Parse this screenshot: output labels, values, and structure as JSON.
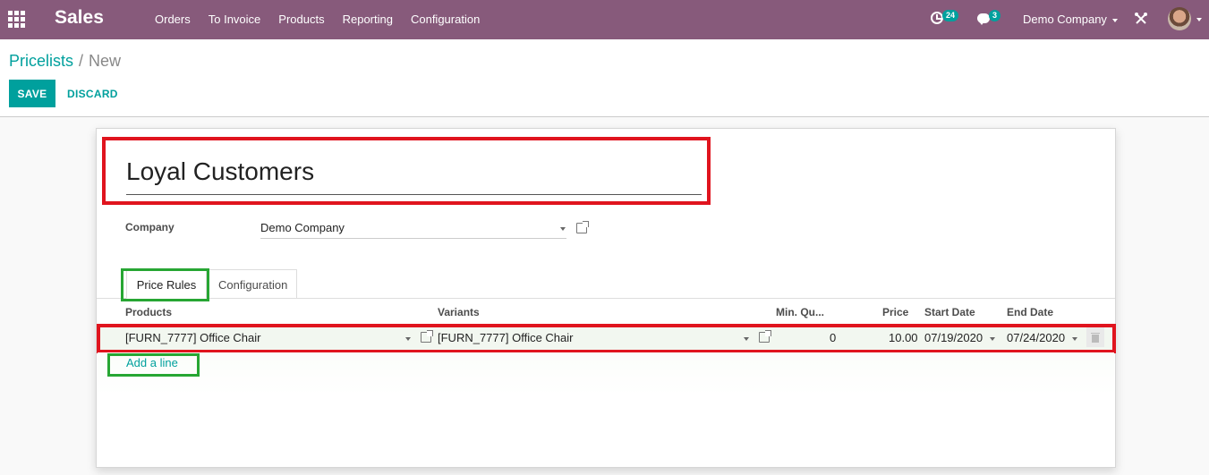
{
  "navbar": {
    "app_title": "Sales",
    "menu": [
      "Orders",
      "To Invoice",
      "Products",
      "Reporting",
      "Configuration"
    ],
    "activity_count": "24",
    "message_count": "3",
    "company": "Demo Company"
  },
  "breadcrumb": {
    "parent": "Pricelists",
    "separator": "/",
    "current": "New"
  },
  "actions": {
    "save": "SAVE",
    "discard": "DISCARD"
  },
  "form": {
    "name": "Loyal Customers",
    "company_label": "Company",
    "company_value": "Demo Company",
    "tabs": [
      "Price Rules",
      "Configuration"
    ]
  },
  "table": {
    "headers": {
      "products": "Products",
      "variants": "Variants",
      "min_qty": "Min. Qu...",
      "price": "Price",
      "start": "Start Date",
      "end": "End Date"
    },
    "rows": [
      {
        "product": "[FURN_7777] Office Chair",
        "variant": "[FURN_7777] Office Chair",
        "min_qty": "0",
        "price": "10.00",
        "start": "07/19/2020",
        "end": "07/24/2020"
      }
    ],
    "add_line": "Add a line"
  },
  "colors": {
    "navbar": "#875a7b",
    "accent": "#00a09d",
    "highlight_red": "#e0141e",
    "highlight_green": "#27a633"
  }
}
